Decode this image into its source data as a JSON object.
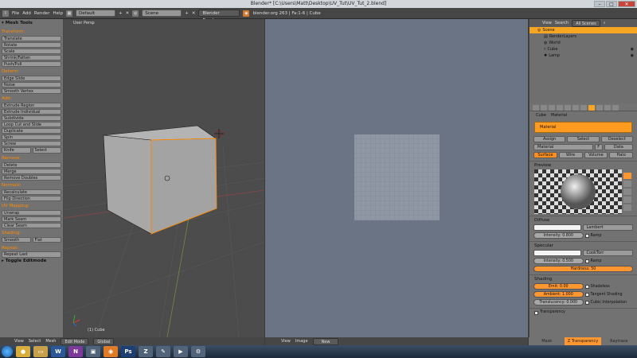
{
  "window": {
    "title": "Blender* [C:\\Users\\Matt\\Desktop\\UV_Tut\\UV_Tut_2.blend]",
    "min": "–",
    "max": "□",
    "close": "✕"
  },
  "info": {
    "menus": [
      "File",
      "Add",
      "Render",
      "Help"
    ],
    "layout": "Default",
    "scene": "Scene",
    "engine": "Blender Render",
    "stats": "blender.org 263 | Fa:1-6 | Cube"
  },
  "toolshelf": {
    "title": "Mesh Tools",
    "sections": [
      {
        "name": "Transform:",
        "buttons": [
          "Translate",
          "Rotate",
          "Scale",
          "Shrink/Fatten",
          "Push/Pull"
        ]
      },
      {
        "name": "Deform:",
        "buttons": [
          "Edge Slide",
          "Noise",
          "Smooth Vertex"
        ]
      },
      {
        "name": "Add:",
        "buttons": [
          "Extrude Region",
          "Extrude Individual",
          "Subdivide",
          "Loop Cut and Slide",
          "Duplicate",
          "Spin",
          "Screw"
        ]
      }
    ],
    "knife": "Knife",
    "select": "Select",
    "remove_label": "Remove:",
    "delete": "Delete",
    "merge": "Merge",
    "remove_doubles": "Remove Doubles",
    "normals_label": "Normals:",
    "recalculate": "Recalculate",
    "flip_direction": "Flip Direction",
    "uv_label": "UV Mapping:",
    "unwrap": "Unwrap",
    "mark_seam": "Mark Seam",
    "clear_seam": "Clear Seam",
    "shading_label": "Shading:",
    "smooth": "Smooth",
    "flat": "Flat",
    "repeat_label": "Repeat:",
    "repeat_last": "Repeat Last",
    "toggle": "Toggle Editmode"
  },
  "viewport3d": {
    "label": "User Persp",
    "object": "(1) Cube"
  },
  "bottom3d": {
    "menus": [
      "View",
      "Select",
      "Mesh"
    ],
    "mode": "Edit Mode",
    "orientation": "Global"
  },
  "bottomuv": {
    "menus": [
      "View",
      "Image"
    ],
    "new": "New"
  },
  "outliner": {
    "menus": [
      "View",
      "Search"
    ],
    "filter": "All Scenes",
    "items": [
      {
        "label": "Scene",
        "sel": true
      },
      {
        "label": "RenderLayers"
      },
      {
        "label": "World"
      },
      {
        "label": "Cube"
      },
      {
        "label": "Lamp"
      }
    ]
  },
  "properties": {
    "context": [
      "Cube",
      "Material"
    ],
    "material_slot": "Material",
    "assign": "Assign",
    "select": "Select",
    "deselect": "Deselect",
    "material_name": "Material",
    "material_users": "F",
    "data": "Data",
    "tabs": [
      "Surface",
      "Wire",
      "Volume",
      "Halo"
    ],
    "preview": "Preview",
    "diffuse": "Diffuse",
    "diffuse_shader": "Lambert",
    "diffuse_intensity": "Intensity: 0.800",
    "ramp": "Ramp",
    "specular": "Specular",
    "specular_shader": "CookTorr",
    "specular_intensity": "Intensity: 0.500",
    "hardness": "Hardness: 50",
    "shading": "Shading",
    "emit": "Emit: 0.00",
    "ambient": "Ambient: 1.000",
    "translucency": "Translucency: 0.000",
    "shadeless": "Shadeless",
    "tangent_shading": "Tangent Shading",
    "cubic": "Cubic Interpolation",
    "transparency": "Transparency",
    "bottom_tabs": [
      "Mask",
      "Z Transparency",
      "Raytrace"
    ]
  },
  "taskbar": {
    "apps": [
      "Chrome",
      "Explorer",
      "W",
      "N",
      "P",
      "Blender",
      "Ps",
      "Z",
      "G",
      "V",
      "S"
    ]
  },
  "colors": {
    "accent": "#ff9630",
    "select": "#f6a623"
  }
}
